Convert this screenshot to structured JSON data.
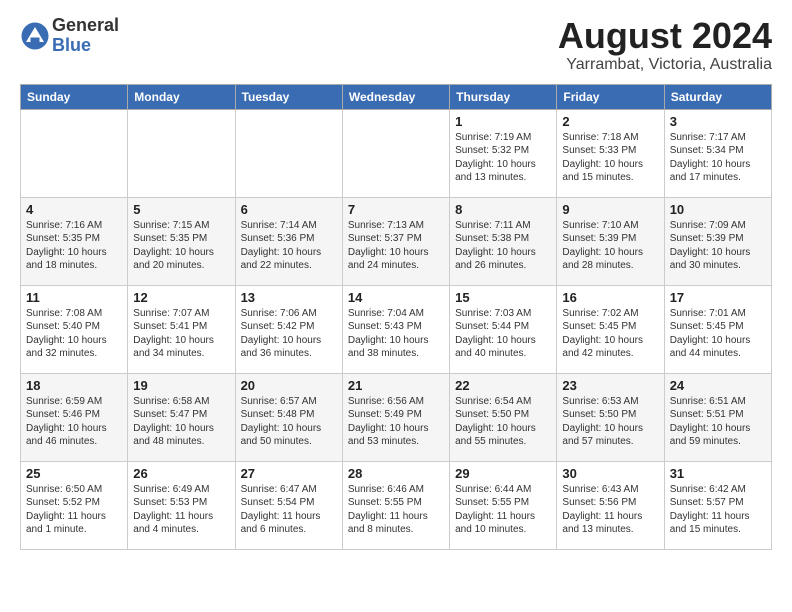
{
  "logo": {
    "general": "General",
    "blue": "Blue"
  },
  "title": {
    "month_year": "August 2024",
    "location": "Yarrambat, Victoria, Australia"
  },
  "days_of_week": [
    "Sunday",
    "Monday",
    "Tuesday",
    "Wednesday",
    "Thursday",
    "Friday",
    "Saturday"
  ],
  "weeks": [
    [
      {
        "day": "",
        "info": ""
      },
      {
        "day": "",
        "info": ""
      },
      {
        "day": "",
        "info": ""
      },
      {
        "day": "",
        "info": ""
      },
      {
        "day": "1",
        "info": "Sunrise: 7:19 AM\nSunset: 5:32 PM\nDaylight: 10 hours\nand 13 minutes."
      },
      {
        "day": "2",
        "info": "Sunrise: 7:18 AM\nSunset: 5:33 PM\nDaylight: 10 hours\nand 15 minutes."
      },
      {
        "day": "3",
        "info": "Sunrise: 7:17 AM\nSunset: 5:34 PM\nDaylight: 10 hours\nand 17 minutes."
      }
    ],
    [
      {
        "day": "4",
        "info": "Sunrise: 7:16 AM\nSunset: 5:35 PM\nDaylight: 10 hours\nand 18 minutes."
      },
      {
        "day": "5",
        "info": "Sunrise: 7:15 AM\nSunset: 5:35 PM\nDaylight: 10 hours\nand 20 minutes."
      },
      {
        "day": "6",
        "info": "Sunrise: 7:14 AM\nSunset: 5:36 PM\nDaylight: 10 hours\nand 22 minutes."
      },
      {
        "day": "7",
        "info": "Sunrise: 7:13 AM\nSunset: 5:37 PM\nDaylight: 10 hours\nand 24 minutes."
      },
      {
        "day": "8",
        "info": "Sunrise: 7:11 AM\nSunset: 5:38 PM\nDaylight: 10 hours\nand 26 minutes."
      },
      {
        "day": "9",
        "info": "Sunrise: 7:10 AM\nSunset: 5:39 PM\nDaylight: 10 hours\nand 28 minutes."
      },
      {
        "day": "10",
        "info": "Sunrise: 7:09 AM\nSunset: 5:39 PM\nDaylight: 10 hours\nand 30 minutes."
      }
    ],
    [
      {
        "day": "11",
        "info": "Sunrise: 7:08 AM\nSunset: 5:40 PM\nDaylight: 10 hours\nand 32 minutes."
      },
      {
        "day": "12",
        "info": "Sunrise: 7:07 AM\nSunset: 5:41 PM\nDaylight: 10 hours\nand 34 minutes."
      },
      {
        "day": "13",
        "info": "Sunrise: 7:06 AM\nSunset: 5:42 PM\nDaylight: 10 hours\nand 36 minutes."
      },
      {
        "day": "14",
        "info": "Sunrise: 7:04 AM\nSunset: 5:43 PM\nDaylight: 10 hours\nand 38 minutes."
      },
      {
        "day": "15",
        "info": "Sunrise: 7:03 AM\nSunset: 5:44 PM\nDaylight: 10 hours\nand 40 minutes."
      },
      {
        "day": "16",
        "info": "Sunrise: 7:02 AM\nSunset: 5:45 PM\nDaylight: 10 hours\nand 42 minutes."
      },
      {
        "day": "17",
        "info": "Sunrise: 7:01 AM\nSunset: 5:45 PM\nDaylight: 10 hours\nand 44 minutes."
      }
    ],
    [
      {
        "day": "18",
        "info": "Sunrise: 6:59 AM\nSunset: 5:46 PM\nDaylight: 10 hours\nand 46 minutes."
      },
      {
        "day": "19",
        "info": "Sunrise: 6:58 AM\nSunset: 5:47 PM\nDaylight: 10 hours\nand 48 minutes."
      },
      {
        "day": "20",
        "info": "Sunrise: 6:57 AM\nSunset: 5:48 PM\nDaylight: 10 hours\nand 50 minutes."
      },
      {
        "day": "21",
        "info": "Sunrise: 6:56 AM\nSunset: 5:49 PM\nDaylight: 10 hours\nand 53 minutes."
      },
      {
        "day": "22",
        "info": "Sunrise: 6:54 AM\nSunset: 5:50 PM\nDaylight: 10 hours\nand 55 minutes."
      },
      {
        "day": "23",
        "info": "Sunrise: 6:53 AM\nSunset: 5:50 PM\nDaylight: 10 hours\nand 57 minutes."
      },
      {
        "day": "24",
        "info": "Sunrise: 6:51 AM\nSunset: 5:51 PM\nDaylight: 10 hours\nand 59 minutes."
      }
    ],
    [
      {
        "day": "25",
        "info": "Sunrise: 6:50 AM\nSunset: 5:52 PM\nDaylight: 11 hours\nand 1 minute."
      },
      {
        "day": "26",
        "info": "Sunrise: 6:49 AM\nSunset: 5:53 PM\nDaylight: 11 hours\nand 4 minutes."
      },
      {
        "day": "27",
        "info": "Sunrise: 6:47 AM\nSunset: 5:54 PM\nDaylight: 11 hours\nand 6 minutes."
      },
      {
        "day": "28",
        "info": "Sunrise: 6:46 AM\nSunset: 5:55 PM\nDaylight: 11 hours\nand 8 minutes."
      },
      {
        "day": "29",
        "info": "Sunrise: 6:44 AM\nSunset: 5:55 PM\nDaylight: 11 hours\nand 10 minutes."
      },
      {
        "day": "30",
        "info": "Sunrise: 6:43 AM\nSunset: 5:56 PM\nDaylight: 11 hours\nand 13 minutes."
      },
      {
        "day": "31",
        "info": "Sunrise: 6:42 AM\nSunset: 5:57 PM\nDaylight: 11 hours\nand 15 minutes."
      }
    ]
  ]
}
